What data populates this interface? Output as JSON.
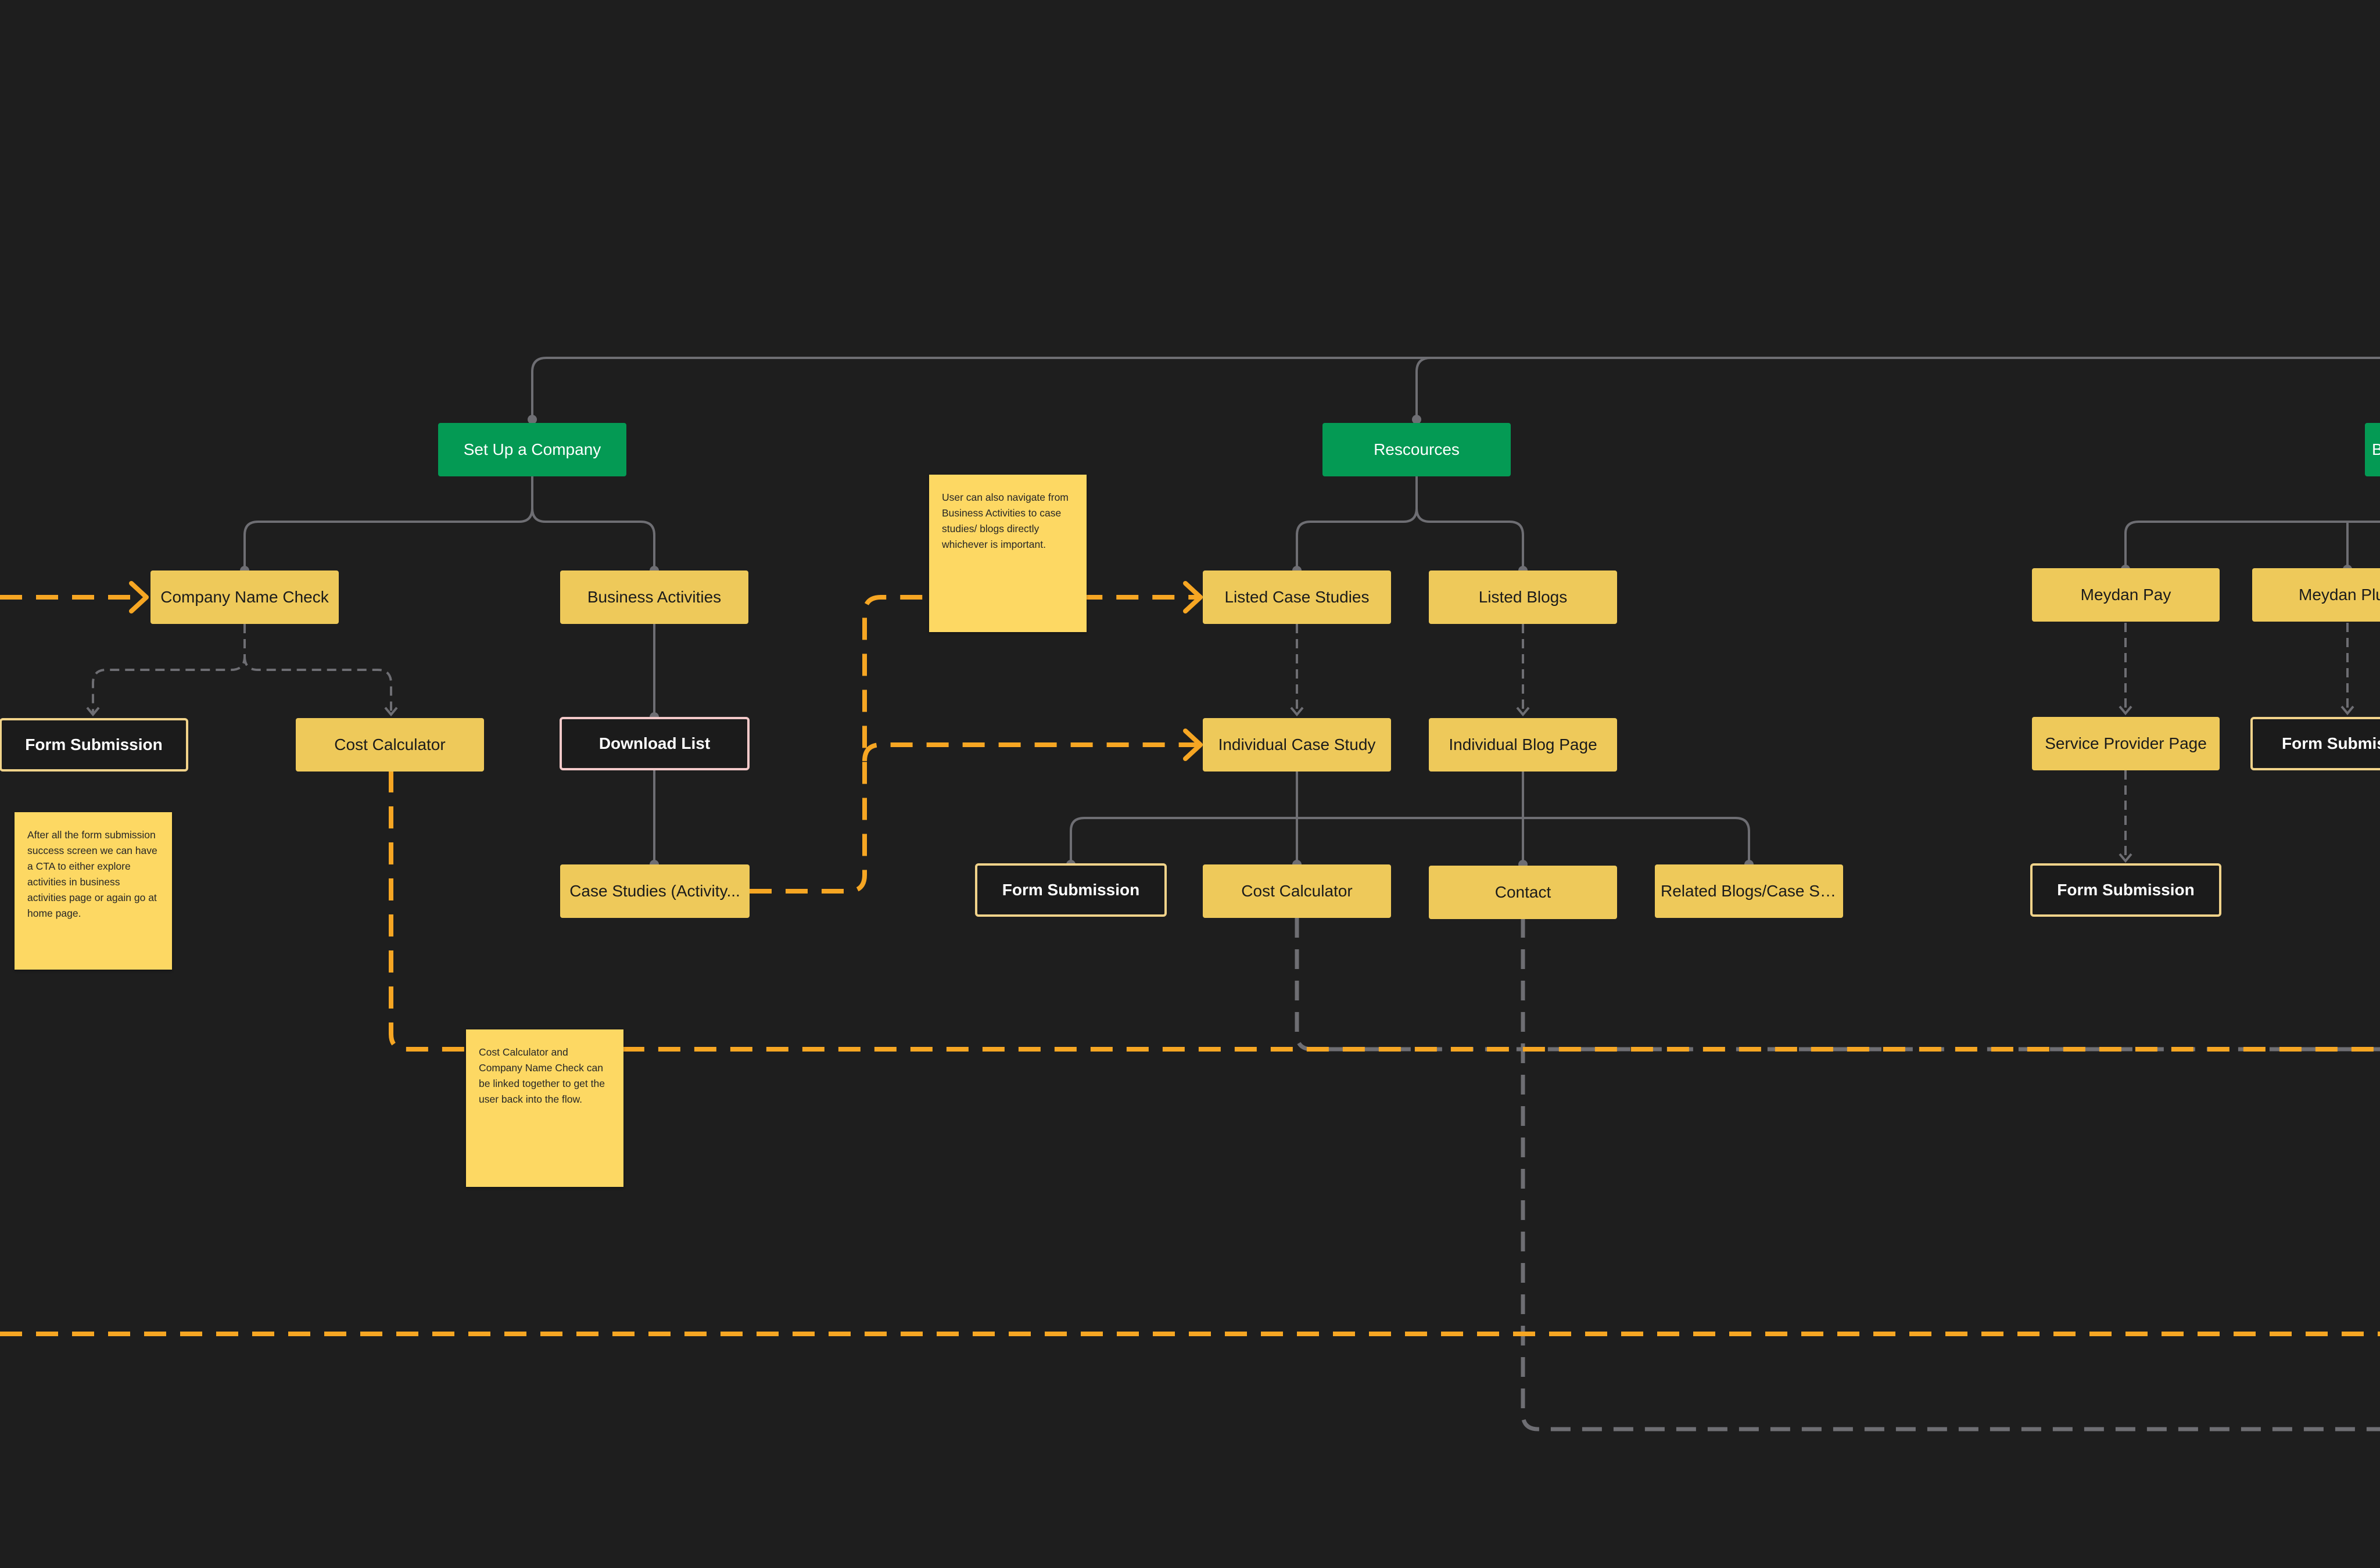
{
  "nodes": {
    "set_up_company": "Set Up a Company",
    "resources": "Rescources",
    "company_name_check": "Company Name Check",
    "business_activities": "Business Activities",
    "form_submission_left": "Form Submission",
    "cost_calculator_left": "Cost Calculator",
    "download_list": "Download List",
    "case_studies_activity": "Case Studies (Activity...",
    "listed_case_studies": "Listed Case Studies",
    "listed_blogs": "Listed Blogs",
    "individual_case_study": "Individual Case Study",
    "individual_blog_page": "Individual Blog Page",
    "form_submission_mid": "Form Submission",
    "cost_calculator_mid": "Cost Calculator",
    "contact": "Contact",
    "related_blogs": "Related Blogs/Case St...",
    "meydan_pay": "Meydan Pay",
    "meydan_plus": "Meydan Plu",
    "service_provider_page": "Service Provider Page",
    "form_submission_right": "Form Submission",
    "form_submission_far_right": "Form Submis",
    "cut_off_green": "B"
  },
  "notes": {
    "form_submission_note": "After all the form submission success screen we can have a CTA to either explore activities in business activities page or again go at home page.",
    "case_studies_note": "User can also navigate from Business Activities to case studies/ blogs directly whichever is important.",
    "cost_calculator_note": "Cost Calculator and Company Name Check can be linked together to get the user back into the flow."
  },
  "colors": {
    "background": "#1e1e1e",
    "primary_green": "#049a54",
    "page_yellow": "#eec95a",
    "sticky_yellow": "#fdd863",
    "flow_orange": "#f6a623",
    "connector_gray": "#6e6e73"
  }
}
